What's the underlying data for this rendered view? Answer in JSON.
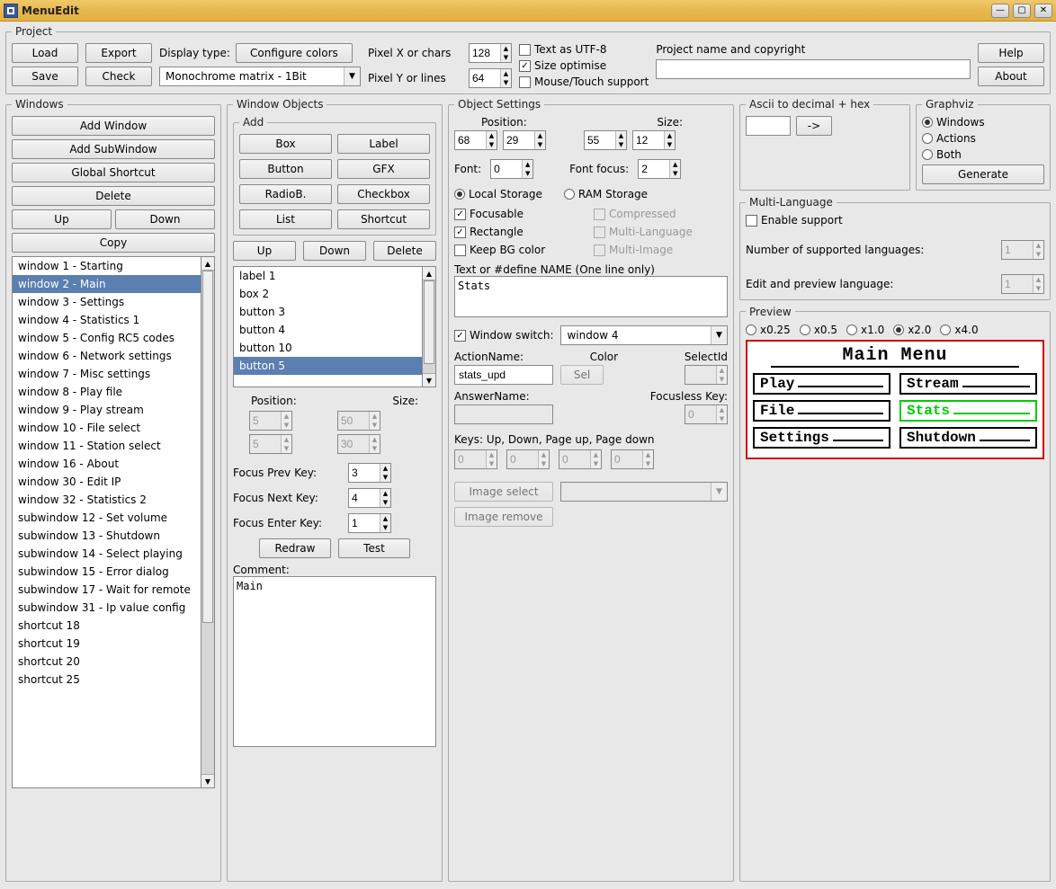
{
  "titlebar": {
    "title": "MenuEdit"
  },
  "project": {
    "legend": "Project",
    "load": "Load",
    "export": "Export",
    "save": "Save",
    "check": "Check",
    "display_type_label": "Display type:",
    "configure_colors": "Configure colors",
    "display_type": "Monochrome matrix - 1Bit",
    "pixel_x_label": "Pixel X or chars",
    "pixel_y_label": "Pixel Y or lines",
    "pixel_x": "128",
    "pixel_y": "64",
    "text_utf8": "Text as UTF-8",
    "size_optimise": "Size optimise",
    "mouse_touch": "Mouse/Touch support",
    "project_name_label": "Project name and copyright",
    "project_name": "",
    "help": "Help",
    "about": "About"
  },
  "windows": {
    "legend": "Windows",
    "add_window": "Add Window",
    "add_subwindow": "Add SubWindow",
    "global_shortcut": "Global Shortcut",
    "delete": "Delete",
    "up": "Up",
    "down": "Down",
    "copy": "Copy",
    "items": [
      "window 1 - Starting",
      "window 2 - Main",
      "window 3 - Settings",
      "window 4 - Statistics 1",
      "window 5 - Config RC5 codes",
      "window 6 - Network settings",
      "window 7 - Misc settings",
      "window 8 - Play file",
      "window 9 - Play stream",
      "window 10 - File select",
      "window 11 - Station select",
      "window 16 - About",
      "window 30 - Edit IP",
      "window 32 - Statistics 2",
      "subwindow 12 - Set volume",
      "subwindow 13 - Shutdown",
      "subwindow 14 - Select playing",
      "subwindow 15 - Error dialog",
      "subwindow 17 - Wait for remote",
      "subwindow 31 - Ip value config",
      "shortcut 18",
      "shortcut 19",
      "shortcut 20",
      "shortcut 25"
    ],
    "selected_index": 1
  },
  "wobjects": {
    "legend": "Window Objects",
    "add_legend": "Add",
    "add": [
      "Box",
      "Label",
      "Button",
      "GFX",
      "RadioB.",
      "Checkbox",
      "List",
      "Shortcut"
    ],
    "up": "Up",
    "down": "Down",
    "delete": "Delete",
    "items": [
      "label 1",
      "box 2",
      "button 3",
      "button 4",
      "button 10",
      "button 5"
    ],
    "selected_index": 5,
    "position_label": "Position:",
    "size_label": "Size:",
    "pos_x": "5",
    "pos_y": "5",
    "size_w": "50",
    "size_h": "30",
    "focus_prev_label": "Focus Prev Key:",
    "focus_prev": "3",
    "focus_next_label": "Focus Next Key:",
    "focus_next": "4",
    "focus_enter_label": "Focus Enter Key:",
    "focus_enter": "1",
    "redraw": "Redraw",
    "test": "Test",
    "comment_label": "Comment:",
    "comment": "Main"
  },
  "objset": {
    "legend": "Object Settings",
    "position_label": "Position:",
    "size_label": "Size:",
    "pos_x": "68",
    "pos_y": "29",
    "size_w": "55",
    "size_h": "12",
    "font_label": "Font:",
    "font": "0",
    "font_focus_label": "Font focus:",
    "font_focus": "2",
    "local_storage": "Local Storage",
    "ram_storage": "RAM Storage",
    "focusable": "Focusable",
    "compressed": "Compressed",
    "rectangle": "Rectangle",
    "multi_language": "Multi-Language",
    "keep_bg": "Keep BG color",
    "multi_image": "Multi-Image",
    "text_label": "Text or #define NAME (One line only)",
    "text": "Stats",
    "window_switch_label": "Window switch:",
    "window_switch": "window 4",
    "action_name_label": "ActionName:",
    "action_name": "stats_upd",
    "color_label": "Color",
    "sel_btn": "Sel",
    "selectid_label": "SelectId",
    "selectid": "",
    "answer_name_label": "AnswerName:",
    "answer_name": "",
    "focusless_key_label": "Focusless Key:",
    "focusless_key": "0",
    "keys_label": "Keys: Up, Down, Page up, Page down",
    "keys": [
      "0",
      "0",
      "0",
      "0"
    ],
    "image_select": "Image select",
    "image_remove": "Image remove"
  },
  "ascii": {
    "legend": "Ascii to decimal + hex",
    "arrow": "->",
    "input": ""
  },
  "graphviz": {
    "legend": "Graphviz",
    "windows": "Windows",
    "actions": "Actions",
    "both": "Both",
    "generate": "Generate"
  },
  "multilang": {
    "legend": "Multi-Language",
    "enable": "Enable support",
    "num_langs_label": "Number of supported languages:",
    "num_langs": "1",
    "edit_lang_label": "Edit and preview language:",
    "edit_lang": "1"
  },
  "preview": {
    "legend": "Preview",
    "zoom_options": [
      "x0.25",
      "x0.5",
      "x1.0",
      "x2.0",
      "x4.0"
    ],
    "zoom_selected": "x2.0",
    "screen_title": "Main Menu",
    "buttons": [
      "Play",
      "Stream",
      "File",
      "Stats",
      "Settings",
      "Shutdown"
    ],
    "focus_index": 3
  }
}
